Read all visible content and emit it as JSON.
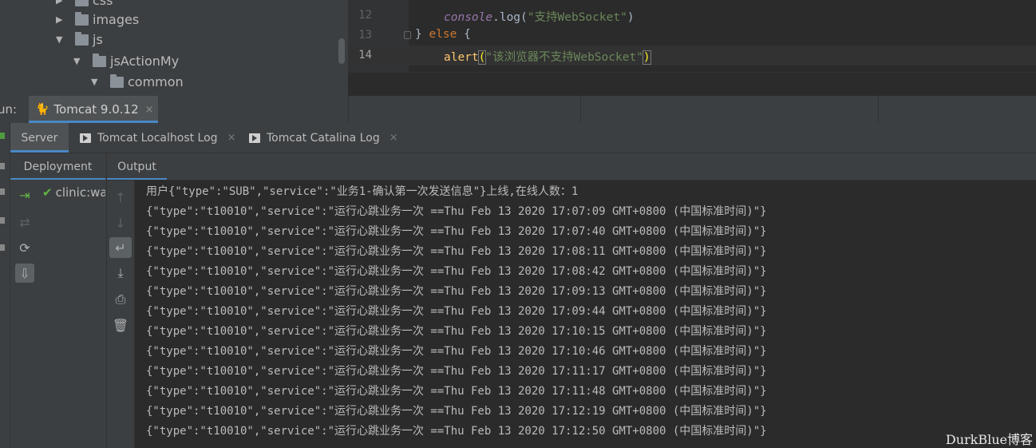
{
  "project_tree": {
    "items": [
      {
        "label": "css",
        "arrow": "▶"
      },
      {
        "label": "images",
        "arrow": "▶"
      },
      {
        "label": "js",
        "arrow": "▼"
      },
      {
        "label": "jsActionMy",
        "arrow": "▼"
      },
      {
        "label": "common",
        "arrow": "▼"
      }
    ]
  },
  "editor": {
    "lines": [
      {
        "number": "12"
      },
      {
        "number": "13"
      },
      {
        "number": "14"
      }
    ],
    "line12": {
      "obj": "console",
      "dot": ".",
      "fn": "log",
      "open": "(",
      "str": "\"支持WebSocket\"",
      "close": ")"
    },
    "line13": {
      "close_brace": "}",
      "kw": "else",
      "open_brace": "{"
    },
    "line14": {
      "fn": "alert",
      "open": "(",
      "str": "\"该浏览器不支持WebSocket\"",
      "close": ")"
    }
  },
  "run_window": {
    "label": "un:",
    "tab": {
      "label": "Tomcat 9.0.12",
      "close": "×"
    }
  },
  "services": {
    "tabs": [
      {
        "label": "Server"
      },
      {
        "label": "Tomcat Localhost Log",
        "close": "×"
      },
      {
        "label": "Tomcat Catalina Log",
        "close": "×"
      }
    ]
  },
  "deployment": {
    "tab_label": "Deployment",
    "items": [
      {
        "label": "clinic:war"
      }
    ]
  },
  "output": {
    "tab_label": "Output",
    "lines": [
      "用户{\"type\":\"SUB\",\"service\":\"业务1-确认第一次发送信息\"}上线,在线人数：1",
      "{\"type\":\"t10010\",\"service\":\"运行心跳业务一次 ==Thu Feb 13 2020 17:07:09 GMT+0800 (中国标准时间)\"}",
      "{\"type\":\"t10010\",\"service\":\"运行心跳业务一次 ==Thu Feb 13 2020 17:07:40 GMT+0800 (中国标准时间)\"}",
      "{\"type\":\"t10010\",\"service\":\"运行心跳业务一次 ==Thu Feb 13 2020 17:08:11 GMT+0800 (中国标准时间)\"}",
      "{\"type\":\"t10010\",\"service\":\"运行心跳业务一次 ==Thu Feb 13 2020 17:08:42 GMT+0800 (中国标准时间)\"}",
      "{\"type\":\"t10010\",\"service\":\"运行心跳业务一次 ==Thu Feb 13 2020 17:09:13 GMT+0800 (中国标准时间)\"}",
      "{\"type\":\"t10010\",\"service\":\"运行心跳业务一次 ==Thu Feb 13 2020 17:09:44 GMT+0800 (中国标准时间)\"}",
      "{\"type\":\"t10010\",\"service\":\"运行心跳业务一次 ==Thu Feb 13 2020 17:10:15 GMT+0800 (中国标准时间)\"}",
      "{\"type\":\"t10010\",\"service\":\"运行心跳业务一次 ==Thu Feb 13 2020 17:10:46 GMT+0800 (中国标准时间)\"}",
      "{\"type\":\"t10010\",\"service\":\"运行心跳业务一次 ==Thu Feb 13 2020 17:11:17 GMT+0800 (中国标准时间)\"}",
      "{\"type\":\"t10010\",\"service\":\"运行心跳业务一次 ==Thu Feb 13 2020 17:11:48 GMT+0800 (中国标准时间)\"}",
      "{\"type\":\"t10010\",\"service\":\"运行心跳业务一次 ==Thu Feb 13 2020 17:12:19 GMT+0800 (中国标准时间)\"}",
      "{\"type\":\"t10010\",\"service\":\"运行心跳业务一次 ==Thu Feb 13 2020 17:12:50 GMT+0800 (中国标准时间)\"}"
    ]
  },
  "icons": {
    "deploy_toolbar": [
      "deploy-icon",
      "undeploy-icon",
      "refresh-icon",
      "deploy-all-icon"
    ],
    "output_toolbar": [
      "scroll-up-icon",
      "scroll-down-icon",
      "soft-wrap-icon",
      "scroll-to-end-icon",
      "print-icon",
      "clear-all-icon"
    ]
  },
  "watermark": "DurkBlue博客",
  "colors": {
    "accent": "#4a88c7",
    "panel_bg": "#3c3f41",
    "editor_bg": "#2b2b2b",
    "success": "#62b543"
  }
}
